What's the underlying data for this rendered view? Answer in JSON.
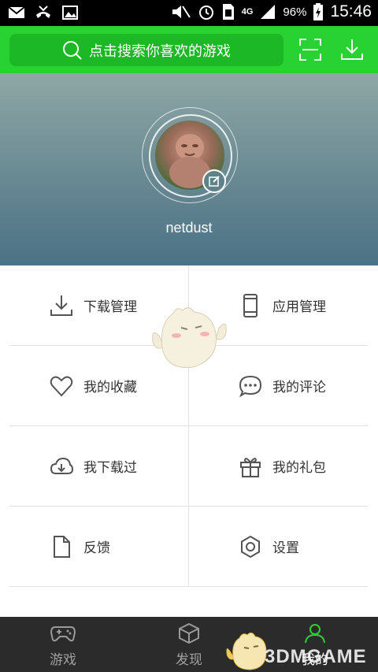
{
  "status_bar": {
    "battery_percent": "96%",
    "time": "15:46",
    "network": "4G"
  },
  "top_bar": {
    "search_placeholder": "点击搜索你喜欢的游戏",
    "accent_color": "#27d232"
  },
  "profile": {
    "username": "netdust"
  },
  "menu": {
    "download_manage": "下载管理",
    "app_manage": "应用管理",
    "favorites": "我的收藏",
    "comments": "我的评论",
    "downloaded": "我下载过",
    "gifts": "我的礼包",
    "feedback": "反馈",
    "settings": "设置"
  },
  "tabs": {
    "games": "游戏",
    "discover": "发现",
    "mine": "我的"
  },
  "watermark": {
    "text": "3DMGAME"
  }
}
